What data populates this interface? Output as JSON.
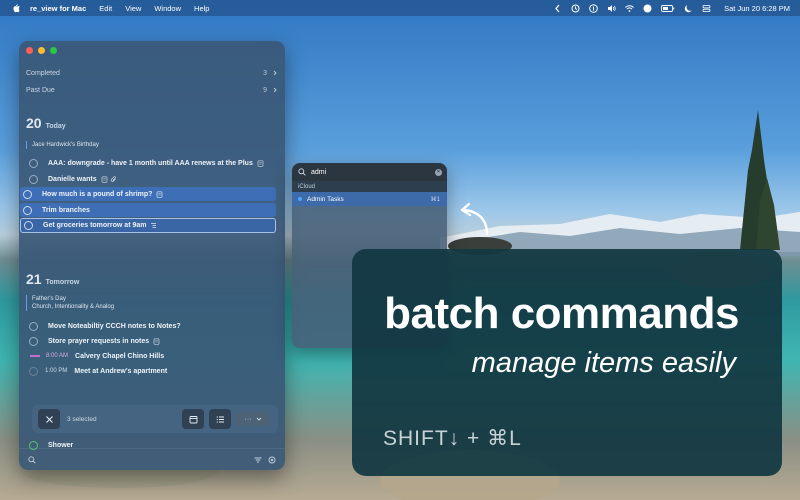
{
  "menubar": {
    "app_name": "re_view for Mac",
    "menus": [
      "Edit",
      "View",
      "Window",
      "Help"
    ],
    "clock": "Sat Jun 20  6:28 PM"
  },
  "sidebar": {
    "completed_label": "Completed",
    "completed_count": "3",
    "past_due_label": "Past Due",
    "past_due_count": "9"
  },
  "today": {
    "day_number": "20",
    "day_word": "Today",
    "event": "Jace Hardwick's Birthday",
    "tasks": [
      "AAA: downgrade - have 1 month until AAA renews at the Plus",
      "Danielle wants",
      "How much is a pound of shrimp?",
      "Trim branches",
      "Get groceries tomorrow at 9am"
    ]
  },
  "tomorrow": {
    "day_number": "21",
    "day_word": "Tomorrow",
    "event_line1": "Father's Day",
    "event_line2": "Church, Intentionality & Analog",
    "tasks": [
      "Move Noteabiltiy CCCH notes to Notes?",
      "Store prayer requests in notes"
    ],
    "calendar": [
      {
        "time": "8:00 AM",
        "title": "Calvery Chapel Chino Hills"
      },
      {
        "time": "1:00 PM",
        "title": "Meet at Andrew's apartment"
      }
    ],
    "last_task": "Shower"
  },
  "batch_bar": {
    "selected_label": "3 selected",
    "more_label": "···"
  },
  "popup": {
    "search_value": "admi",
    "group_label": "iCloud",
    "result_label": "Admin Tasks",
    "result_shortcut": "⌘1"
  },
  "promo": {
    "headline": "batch commands",
    "subheadline": "manage items easily",
    "shortcut": "SHIFT↓ + ⌘L"
  },
  "colors": {
    "selection": "#3e6fb6",
    "promo_bg": "#123842",
    "accent_blue": "#4da3ff"
  }
}
